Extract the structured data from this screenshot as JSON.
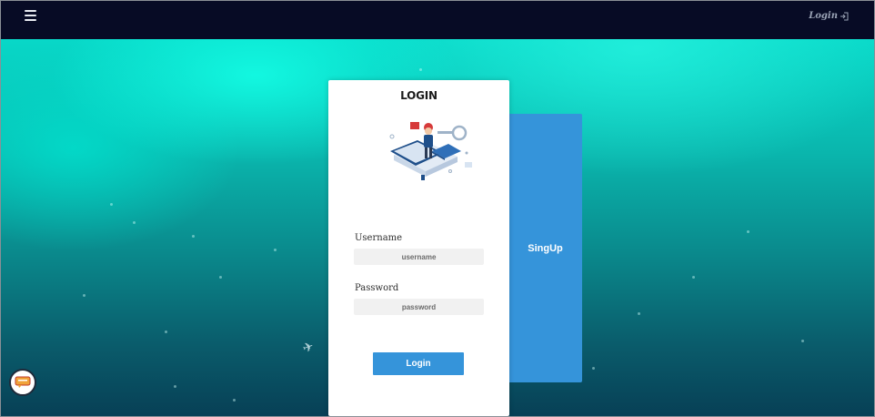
{
  "navbar": {
    "menu_icon": "hamburger-menu-icon",
    "login_label": "Login",
    "login_icon": "sign-in-icon",
    "background": "#070b25"
  },
  "login_card": {
    "title": "LOGIN",
    "illustration_icon": "isometric-user-login-illustration",
    "username": {
      "label": "Username",
      "value": "",
      "placeholder": "username"
    },
    "password": {
      "label": "Password",
      "value": "",
      "placeholder": "password"
    },
    "submit_label": "Login"
  },
  "signup_panel": {
    "label": "SingUp"
  },
  "chat_widget": {
    "icon": "chat-bubble-icon"
  },
  "colors": {
    "accent": "#3594da",
    "hero_top": "#08d8c8",
    "hero_bottom": "#073f55"
  }
}
